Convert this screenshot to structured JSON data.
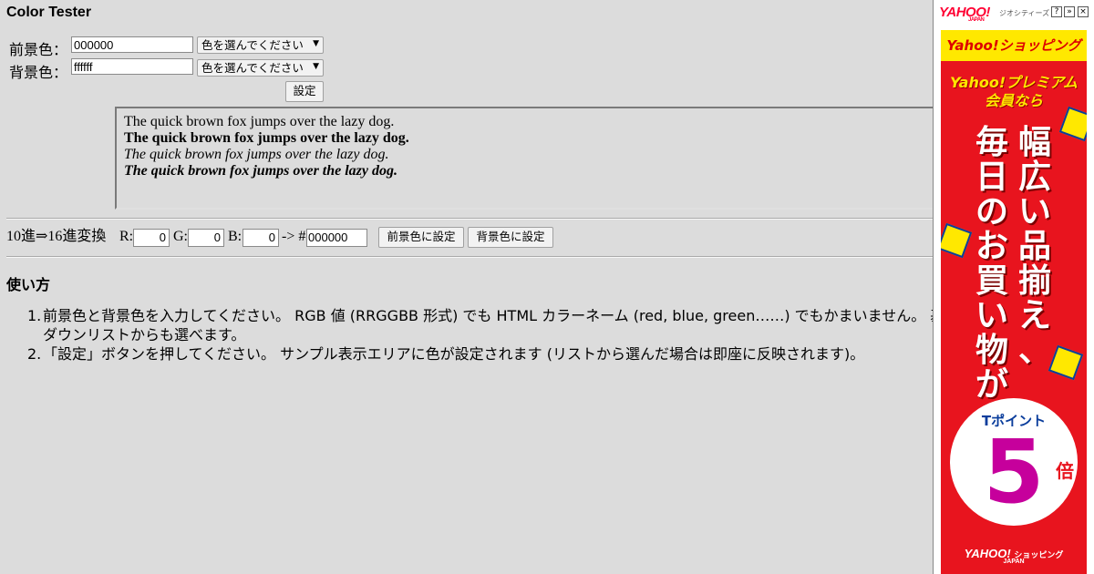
{
  "app": {
    "title": "Color Tester"
  },
  "form": {
    "fg_label": "前景色：",
    "fg_value": "000000",
    "bg_label": "背景色：",
    "bg_value": "ffffff",
    "select_placeholder": "色を選んでください",
    "set_button": "設定"
  },
  "sample": {
    "lines": [
      "The quick brown fox jumps over the lazy dog.",
      "The quick brown fox jumps over the lazy dog.",
      "The quick brown fox jumps over the lazy dog.",
      "The quick brown fox jumps over the lazy dog."
    ]
  },
  "converter": {
    "label": "10進⇒16進変換",
    "r_label": "R:",
    "r_value": "0",
    "g_label": "G:",
    "g_value": "0",
    "b_label": "B:",
    "b_value": "0",
    "arrow": "-> #",
    "hex_value": "000000",
    "set_fg_button": "前景色に設定",
    "set_bg_button": "背景色に設定"
  },
  "usage": {
    "heading": "使い方",
    "steps": [
      {
        "num": "1.",
        "line1": "前景色と背景色を入力してください。 RGB 値 (RRGGBB 形式) でも HTML カラーネーム (red, blue, green……) でもかまいません。 基本の",
        "line2": "ダウンリストからも選べます。"
      },
      {
        "num": "2.",
        "line1": "「設定」ボタンを押してください。 サンプル表示エリアに色が設定されます (リストから選んだ場合は即座に反映されます)。",
        "line2": ""
      }
    ]
  },
  "ad": {
    "logo": "YAHOO!",
    "logo_sub": "JAPAN",
    "network": "ジオシティーズ",
    "controls": [
      "?",
      "»",
      "×"
    ],
    "shop_title": "Yahoo!ショッピング",
    "premium_line1": "Yahoo!プレミアム",
    "premium_line2": "会員なら",
    "col_right": "幅広い品揃え、",
    "col_left": "毎日のお買い物が",
    "tpoint": "Tポイント",
    "multiplier": "5",
    "bai": "倍",
    "footer": "YAHOO!",
    "footer_sub": "ショッピング",
    "footer_japan": "JAPAN",
    "colors": {
      "red": "#e8141e",
      "yellow": "#ffe800",
      "navy": "#0a3d9c"
    }
  }
}
